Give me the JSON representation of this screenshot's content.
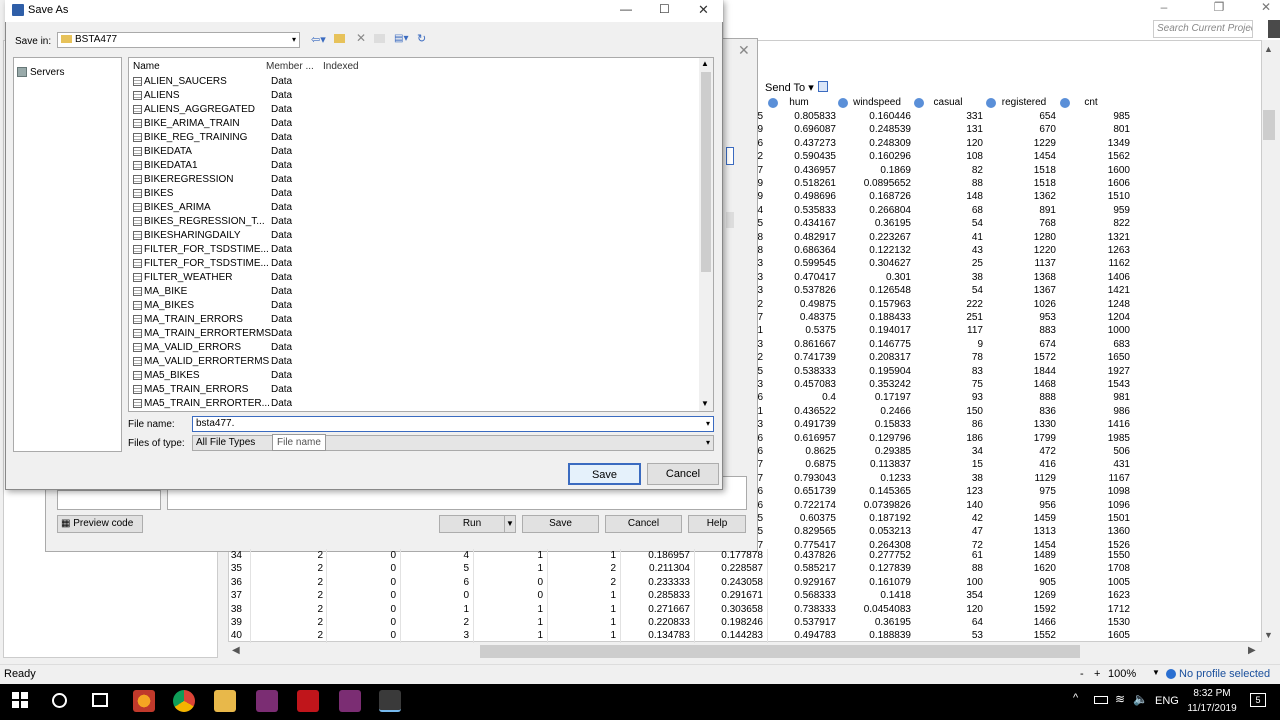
{
  "app": {
    "search_placeholder": "Search Current Project",
    "send_to": "Send To",
    "status_left": "Ready",
    "zoom_minus": "-",
    "zoom_plus": "+",
    "zoom": "100%",
    "profile": "No profile selected",
    "columns": [
      "hum",
      "windspeed",
      "casual",
      "registered",
      "cnt"
    ],
    "top_rows": [
      [
        "5",
        "0.805833",
        "0.160446",
        "331",
        "654",
        "985"
      ],
      [
        "9",
        "0.696087",
        "0.248539",
        "131",
        "670",
        "801"
      ],
      [
        "6",
        "0.437273",
        "0.248309",
        "120",
        "1229",
        "1349"
      ],
      [
        "2",
        "0.590435",
        "0.160296",
        "108",
        "1454",
        "1562"
      ],
      [
        "7",
        "0.436957",
        "0.1869",
        "82",
        "1518",
        "1600"
      ],
      [
        "9",
        "0.518261",
        "0.0895652",
        "88",
        "1518",
        "1606"
      ],
      [
        "9",
        "0.498696",
        "0.168726",
        "148",
        "1362",
        "1510"
      ],
      [
        "4",
        "0.535833",
        "0.266804",
        "68",
        "891",
        "959"
      ],
      [
        "5",
        "0.434167",
        "0.36195",
        "54",
        "768",
        "822"
      ],
      [
        "8",
        "0.482917",
        "0.223267",
        "41",
        "1280",
        "1321"
      ],
      [
        "8",
        "0.686364",
        "0.122132",
        "43",
        "1220",
        "1263"
      ],
      [
        "3",
        "0.599545",
        "0.304627",
        "25",
        "1137",
        "1162"
      ],
      [
        "3",
        "0.470417",
        "0.301",
        "38",
        "1368",
        "1406"
      ],
      [
        "3",
        "0.537826",
        "0.126548",
        "54",
        "1367",
        "1421"
      ],
      [
        "2",
        "0.49875",
        "0.157963",
        "222",
        "1026",
        "1248"
      ],
      [
        "7",
        "0.48375",
        "0.188433",
        "251",
        "953",
        "1204"
      ],
      [
        "1",
        "0.5375",
        "0.194017",
        "117",
        "883",
        "1000"
      ],
      [
        "3",
        "0.861667",
        "0.146775",
        "9",
        "674",
        "683"
      ],
      [
        "2",
        "0.741739",
        "0.208317",
        "78",
        "1572",
        "1650"
      ],
      [
        "5",
        "0.538333",
        "0.195904",
        "83",
        "1844",
        "1927"
      ],
      [
        "3",
        "0.457083",
        "0.353242",
        "75",
        "1468",
        "1543"
      ],
      [
        "6",
        "0.4",
        "0.17197",
        "93",
        "888",
        "981"
      ],
      [
        "1",
        "0.436522",
        "0.2466",
        "150",
        "836",
        "986"
      ],
      [
        "3",
        "0.491739",
        "0.15833",
        "86",
        "1330",
        "1416"
      ],
      [
        "6",
        "0.616957",
        "0.129796",
        "186",
        "1799",
        "1985"
      ],
      [
        "6",
        "0.8625",
        "0.29385",
        "34",
        "472",
        "506"
      ],
      [
        "7",
        "0.6875",
        "0.113837",
        "15",
        "416",
        "431"
      ],
      [
        "7",
        "0.793043",
        "0.1233",
        "38",
        "1129",
        "1167"
      ],
      [
        "6",
        "0.651739",
        "0.145365",
        "123",
        "975",
        "1098"
      ],
      [
        "6",
        "0.722174",
        "0.0739826",
        "140",
        "956",
        "1096"
      ],
      [
        "5",
        "0.60375",
        "0.187192",
        "42",
        "1459",
        "1501"
      ],
      [
        "5",
        "0.829565",
        "0.053213",
        "47",
        "1313",
        "1360"
      ],
      [
        "7",
        "0.775417",
        "0.264308",
        "72",
        "1454",
        "1526"
      ]
    ],
    "bottom_rows": [
      [
        "34",
        "2",
        "0",
        "4",
        "1",
        "1",
        "0.186957",
        "0.177878",
        "0.437826",
        "0.277752",
        "61",
        "1489",
        "1550"
      ],
      [
        "35",
        "2",
        "0",
        "5",
        "1",
        "2",
        "0.211304",
        "0.228587",
        "0.585217",
        "0.127839",
        "88",
        "1620",
        "1708"
      ],
      [
        "36",
        "2",
        "0",
        "6",
        "0",
        "2",
        "0.233333",
        "0.243058",
        "0.929167",
        "0.161079",
        "100",
        "905",
        "1005"
      ],
      [
        "37",
        "2",
        "0",
        "0",
        "0",
        "1",
        "0.285833",
        "0.291671",
        "0.568333",
        "0.1418",
        "354",
        "1269",
        "1623"
      ],
      [
        "38",
        "2",
        "0",
        "1",
        "1",
        "1",
        "0.271667",
        "0.303658",
        "0.738333",
        "0.0454083",
        "120",
        "1592",
        "1712"
      ],
      [
        "39",
        "2",
        "0",
        "2",
        "1",
        "1",
        "0.220833",
        "0.198246",
        "0.537917",
        "0.36195",
        "64",
        "1466",
        "1530"
      ],
      [
        "40",
        "2",
        "0",
        "3",
        "1",
        "1",
        "0.134783",
        "0.144283",
        "0.494783",
        "0.188839",
        "53",
        "1552",
        "1605"
      ]
    ]
  },
  "task_dialog": {
    "preview_code": "Preview code",
    "run": "Run",
    "save": "Save",
    "cancel": "Cancel",
    "help": "Help"
  },
  "save_as": {
    "title": "Save As",
    "save_in_label": "Save in:",
    "save_in_value": "BSTA477",
    "servers": "Servers",
    "col_name": "Name",
    "col_member": "Member ...",
    "col_indexed": "Indexed",
    "files": [
      "ALIEN_SAUCERS",
      "ALIENS",
      "ALIENS_AGGREGATED",
      "BIKE_ARIMA_TRAIN",
      "BIKE_REG_TRAINING",
      "BIKEDATA",
      "BIKEDATA1",
      "BIKEREGRESSION",
      "BIKES",
      "BIKES_ARIMA",
      "BIKES_REGRESSION_T...",
      "BIKESHARINGDAILY",
      "FILTER_FOR_TSDSTIME...",
      "FILTER_FOR_TSDSTIME...",
      "FILTER_WEATHER",
      "MA_BIKE",
      "MA_BIKES",
      "MA_TRAIN_ERRORS",
      "MA_TRAIN_ERRORTERMS",
      "MA_VALID_ERRORS",
      "MA_VALID_ERRORTERMS",
      "MA5_BIKES",
      "MA5_TRAIN_ERRORS",
      "MA5_TRAIN_ERRORTER..."
    ],
    "file_type": "Data",
    "file_name_label": "File name:",
    "file_name_value": "bsta477.",
    "files_of_type_label": "Files of type:",
    "files_of_type_value": "All File Types",
    "tooltip": "File name",
    "save_btn": "Save",
    "cancel_btn": "Cancel"
  },
  "taskbar": {
    "lang": "ENG",
    "time": "8:32 PM",
    "date": "11/17/2019",
    "notifications": "5"
  }
}
